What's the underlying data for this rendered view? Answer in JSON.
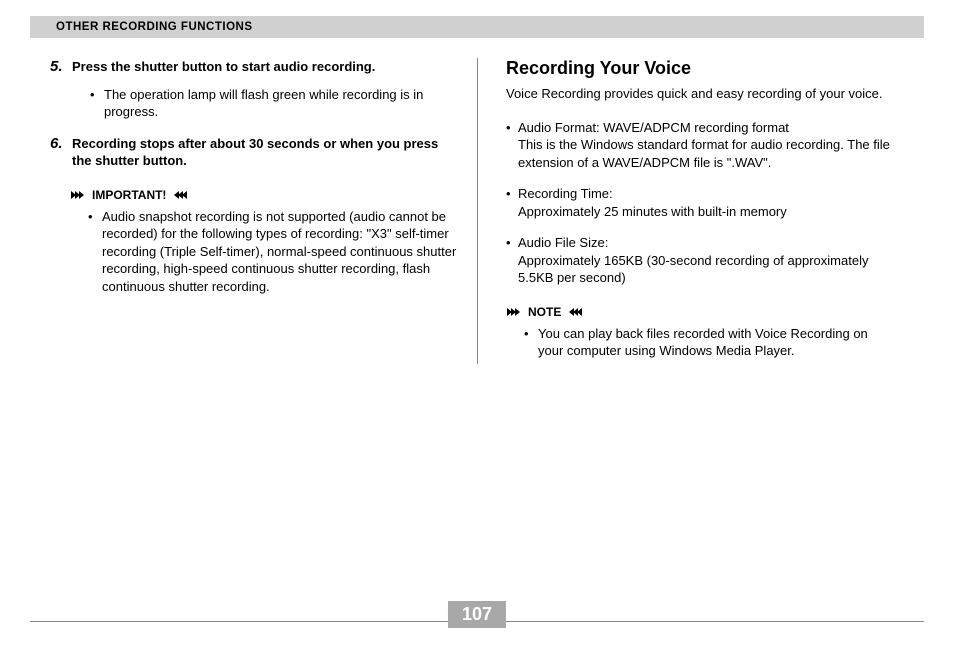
{
  "header": {
    "title": "OTHER RECORDING FUNCTIONS"
  },
  "left": {
    "steps": [
      {
        "num": "5.",
        "text": "Press the shutter button to start audio recording.",
        "bullets": [
          "The operation lamp will flash green while recording is in progress."
        ]
      },
      {
        "num": "6.",
        "text": "Recording stops after about 30 seconds or when you press the shutter button.",
        "bullets": []
      }
    ],
    "important": {
      "label": "IMPORTANT!",
      "bullets": [
        "Audio snapshot recording is not supported (audio cannot be recorded) for the following types of recording: \"X3\" self-timer recording (Triple Self-timer), normal-speed continuous shutter recording, high-speed continuous shutter recording, flash continuous shutter recording."
      ]
    }
  },
  "right": {
    "title": "Recording Your Voice",
    "intro": "Voice Recording provides quick and easy recording of your voice.",
    "specs": [
      {
        "label": "Audio Format: WAVE/ADPCM recording format",
        "detail": "This is the Windows standard format for audio recording. The file extension of a WAVE/ADPCM file is \".WAV\"."
      },
      {
        "label": "Recording Time:",
        "detail": "Approximately 25 minutes with built-in memory"
      },
      {
        "label": "Audio File Size:",
        "detail": "Approximately 165KB (30-second recording of approximately 5.5KB per second)"
      }
    ],
    "note": {
      "label": "NOTE",
      "bullets": [
        "You can play back files recorded with Voice Recording on your computer using Windows Media Player."
      ]
    }
  },
  "pageNumber": "107"
}
